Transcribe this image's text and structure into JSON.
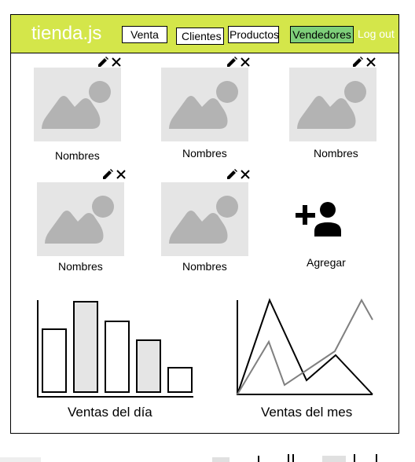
{
  "header": {
    "brand": "tienda.js",
    "nav": {
      "venta": "Venta",
      "clientes": "Clientes",
      "productos": "Productos",
      "vendedores": "Vendedores"
    },
    "logout": "Log out",
    "active_tab": "Vendedores",
    "colors": {
      "bar": "#d4e64a",
      "active_tab": "#7ed07a"
    }
  },
  "sellers": [
    {
      "name": "Nombres",
      "edit_icon": "pencil-icon",
      "delete_icon": "close-icon"
    },
    {
      "name": "Nombres",
      "edit_icon": "pencil-icon",
      "delete_icon": "close-icon"
    },
    {
      "name": "Nombres",
      "edit_icon": "pencil-icon",
      "delete_icon": "close-icon"
    },
    {
      "name": "Nombres",
      "edit_icon": "pencil-icon",
      "delete_icon": "close-icon"
    },
    {
      "name": "Nombres",
      "edit_icon": "pencil-icon",
      "delete_icon": "close-icon"
    }
  ],
  "add_seller": {
    "label": "Agregar",
    "icon": "add-user-icon"
  },
  "chart_data": [
    {
      "type": "bar",
      "title": "Ventas del día",
      "categories": [
        "",
        "",
        "",
        "",
        ""
      ],
      "values": [
        80,
        115,
        90,
        66,
        31
      ],
      "fills": [
        "#ffffff",
        "#e5e5e5",
        "#ffffff",
        "#e5e5e5",
        "#ffffff"
      ],
      "ylim": [
        0,
        120
      ]
    },
    {
      "type": "line",
      "title": "Ventas del mes",
      "x": [
        0,
        1,
        2,
        3,
        4,
        5
      ],
      "series": [
        {
          "values": [
            0,
            120,
            18,
            50,
            0
          ],
          "color": "#000000"
        },
        {
          "values": [
            0,
            67,
            12,
            55,
            120,
            95
          ],
          "color": "#808080"
        }
      ],
      "ylim": [
        0,
        120
      ]
    }
  ]
}
